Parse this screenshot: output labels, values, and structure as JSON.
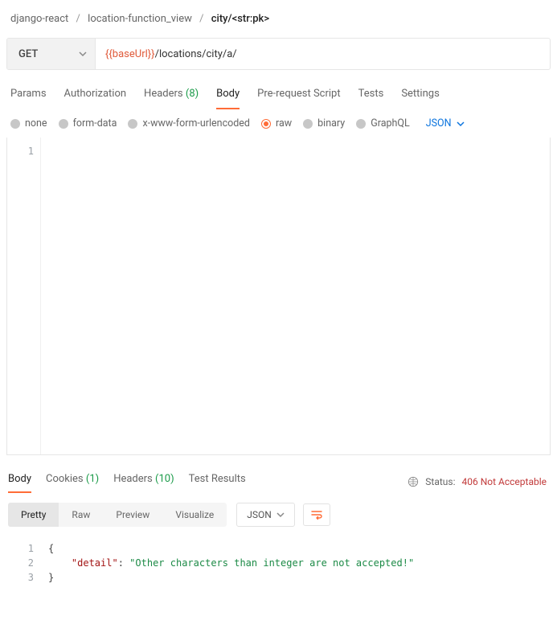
{
  "breadcrumb": {
    "parts": [
      "django-react",
      "location-function_view",
      "city/<str:pk>"
    ]
  },
  "request": {
    "method": "GET",
    "url_var": "{{baseUrl}}",
    "url_path": "/locations/city/a/"
  },
  "tabs": {
    "params": "Params",
    "authorization": "Authorization",
    "headers_label": "Headers",
    "headers_count": "(8)",
    "body": "Body",
    "prerequest": "Pre-request Script",
    "tests": "Tests",
    "settings": "Settings"
  },
  "body_options": {
    "none": "none",
    "formdata": "form-data",
    "urlencoded": "x-www-form-urlencoded",
    "raw": "raw",
    "binary": "binary",
    "graphql": "GraphQL",
    "lang": "JSON"
  },
  "request_body": {
    "lines": [
      ""
    ]
  },
  "response_tabs": {
    "body": "Body",
    "cookies_label": "Cookies",
    "cookies_count": "(1)",
    "headers_label": "Headers",
    "headers_count": "(10)",
    "tests": "Test Results"
  },
  "status": {
    "label": "Status:",
    "value": "406 Not Acceptable"
  },
  "view_controls": {
    "pretty": "Pretty",
    "raw": "Raw",
    "preview": "Preview",
    "visualize": "Visualize",
    "format": "JSON"
  },
  "response_body": {
    "key": "\"detail\"",
    "value": "\"Other characters than integer are not accepted!\""
  }
}
